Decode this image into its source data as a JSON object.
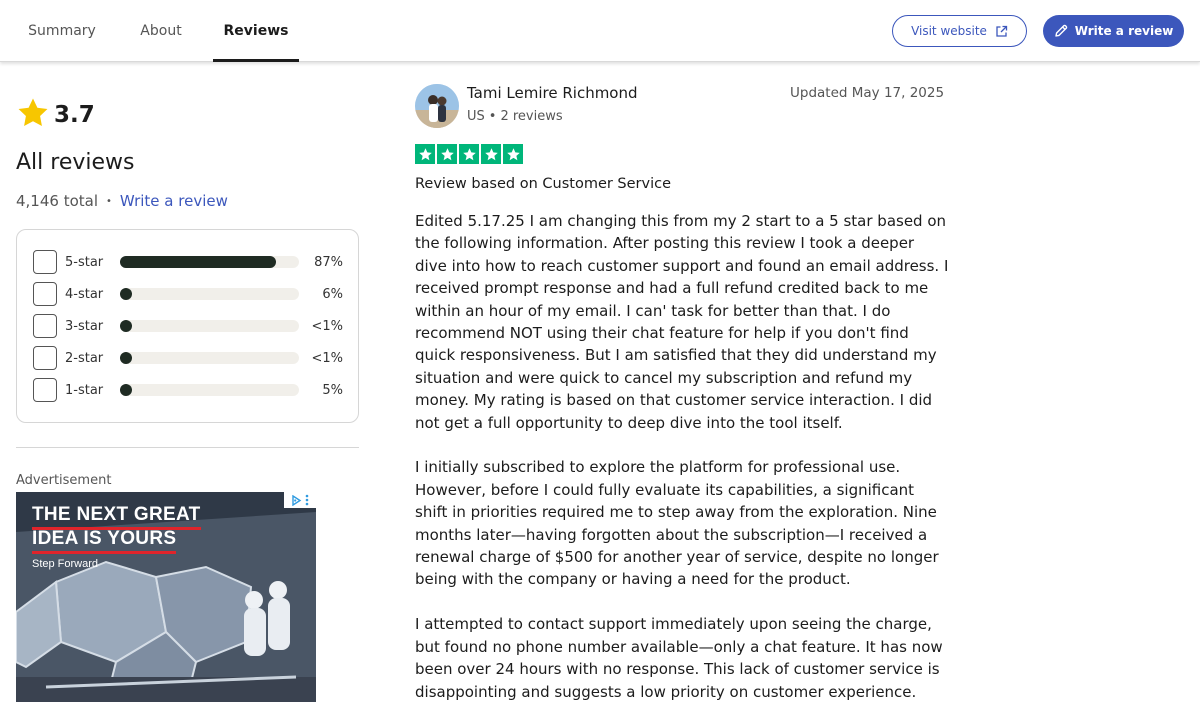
{
  "nav": {
    "tabs": [
      {
        "label": "Summary"
      },
      {
        "label": "About"
      },
      {
        "label": "Reviews"
      }
    ],
    "visit_website": "Visit website",
    "write_review": "Write a review"
  },
  "summary": {
    "rating": "3.7",
    "heading": "All reviews",
    "total": "4,146 total",
    "write_link": "Write a review",
    "distribution": [
      {
        "label": "5-star",
        "percent_text": "87%",
        "fraction": 0.87
      },
      {
        "label": "4-star",
        "percent_text": "6%",
        "fraction": 0.06
      },
      {
        "label": "3-star",
        "percent_text": "<1%",
        "fraction": 0.0
      },
      {
        "label": "2-star",
        "percent_text": "<1%",
        "fraction": 0.0
      },
      {
        "label": "1-star",
        "percent_text": "5%",
        "fraction": 0.05
      }
    ]
  },
  "advertisement": {
    "label": "Advertisement",
    "headline_1": "THE NEXT GREAT",
    "headline_2": "IDEA IS YOURS",
    "tagline": "Step Forward"
  },
  "review": {
    "name": "Tami Lemire Richmond",
    "country": "US",
    "reviews_count": "2 reviews",
    "date": "Updated May 17, 2025",
    "stars": 5,
    "title": "Review based on Customer Service",
    "paragraphs": [
      "Edited 5.17.25 I am changing this from my 2 start to a 5 star based on the following information. After posting this review I took a deeper dive into how to reach customer support and found an email address. I received prompt response and had a full refund credited back to me within an hour of my email. I can' task for better than that. I do recommend NOT using their chat feature for help if you don't find quick responsiveness. But I am satisfied that they did understand my situation and were quick to cancel my subscription and refund my money. My rating is based on that customer service interaction. I did not get a full opportunity to deep dive into the tool itself.",
      "I initially subscribed to explore the platform for professional use. However, before I could fully evaluate its capabilities, a significant shift in priorities required me to step away from the exploration. Nine months later—having forgotten about the subscription—I received a renewal charge of $500 for another year of service, despite no longer being with the company or having a need for the product.",
      "I attempted to contact support immediately upon seeing the charge, but found no phone number available—only a chat feature. It has now been over 24 hours with no response. This lack of customer service is disappointing and suggests a low priority on customer experience."
    ]
  },
  "colors": {
    "accent": "#3c57bc",
    "trustpilot_green": "#00b67a",
    "star_yellow": "#f7c600",
    "bar_fill": "#1f2b23",
    "bar_track": "#f1efea"
  }
}
